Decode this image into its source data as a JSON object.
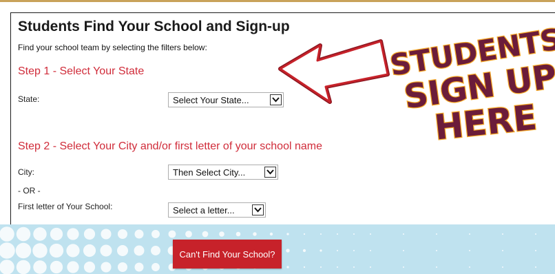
{
  "header": {
    "title": "Students Find Your School and Sign-up",
    "subtitle": "Find your school team by selecting the filters below:"
  },
  "step1": {
    "heading": "Step 1 - Select Your State",
    "state_label": "State:",
    "state_select": "Select Your State..."
  },
  "step2": {
    "heading": "Step 2 - Select Your City and/or first letter of your school name",
    "city_label": "City:",
    "city_select": "Then Select City...",
    "or_label": "- OR -",
    "letter_label": "First letter of Your School:",
    "letter_select": "Select a letter..."
  },
  "promo": {
    "line1": "STUDENTS",
    "line2": "SIGN UP",
    "line3": "HERE",
    "text_color": "#6b1c3a",
    "outline_color": "#f5a623",
    "arrow_color": "#c7222a"
  },
  "footer": {
    "cant_find_button": "Can't Find Your School?",
    "band_color": "#bfe2ef",
    "button_color": "#c7222a"
  }
}
